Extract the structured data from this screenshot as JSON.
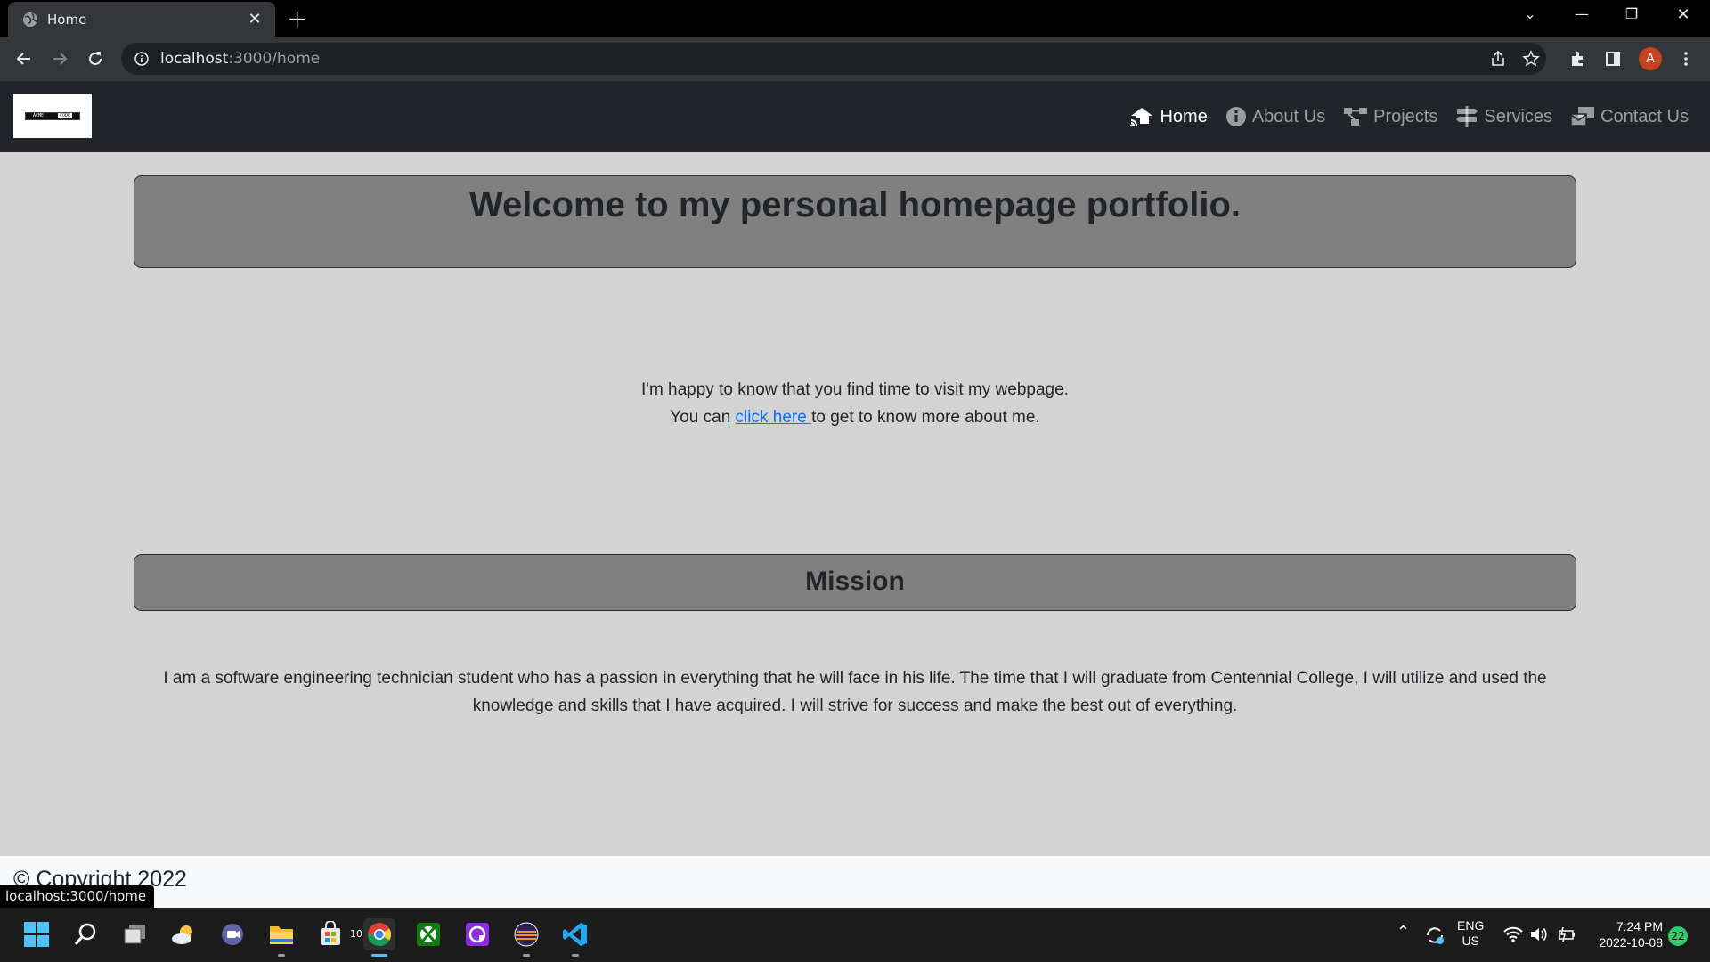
{
  "browser": {
    "tab_title": "Home",
    "url_host": "localhost",
    "url_path": ":3000/home",
    "profile_initial": "A"
  },
  "navbar": {
    "items": [
      {
        "label": "Home",
        "icon": "house-signal-icon",
        "active": true
      },
      {
        "label": "About Us",
        "icon": "info-circle-icon",
        "active": false
      },
      {
        "label": "Projects",
        "icon": "project-diagram-icon",
        "active": false
      },
      {
        "label": "Services",
        "icon": "signs-post-icon",
        "active": false
      },
      {
        "label": "Contact Us",
        "icon": "mail-bulk-icon",
        "active": false
      }
    ]
  },
  "logo_text": [
    "ACME",
    "CODE"
  ],
  "home": {
    "welcome_heading": "Welcome to my personal homepage portfolio.",
    "intro_line1": "I'm happy to know that you find time to visit my webpage.",
    "intro_prefix": "You can ",
    "intro_link": "click here ",
    "intro_suffix": "to get to know more about me.",
    "mission_heading": "Mission",
    "mission_text": "I am a software engineering technician student who has a passion in everything that he will face in his life. The time that I will graduate from Centennial College, I will utilize and used the knowledge and skills that I have acquired. I will strive for success and make the best out of everything."
  },
  "footer": {
    "copyright": "© Copyright 2022"
  },
  "status_url": "localhost:3000/home",
  "taskbar": {
    "weather_temp": "10°",
    "lang_top": "ENG",
    "lang_bottom": "US",
    "time": "7:24 PM",
    "date": "2022-10-08",
    "notification_count": "22"
  },
  "colors": {
    "navbar_bg": "#212529",
    "page_bg": "#d3d3d3",
    "heading_box_bg": "#808080",
    "link": "#0d6efd"
  }
}
